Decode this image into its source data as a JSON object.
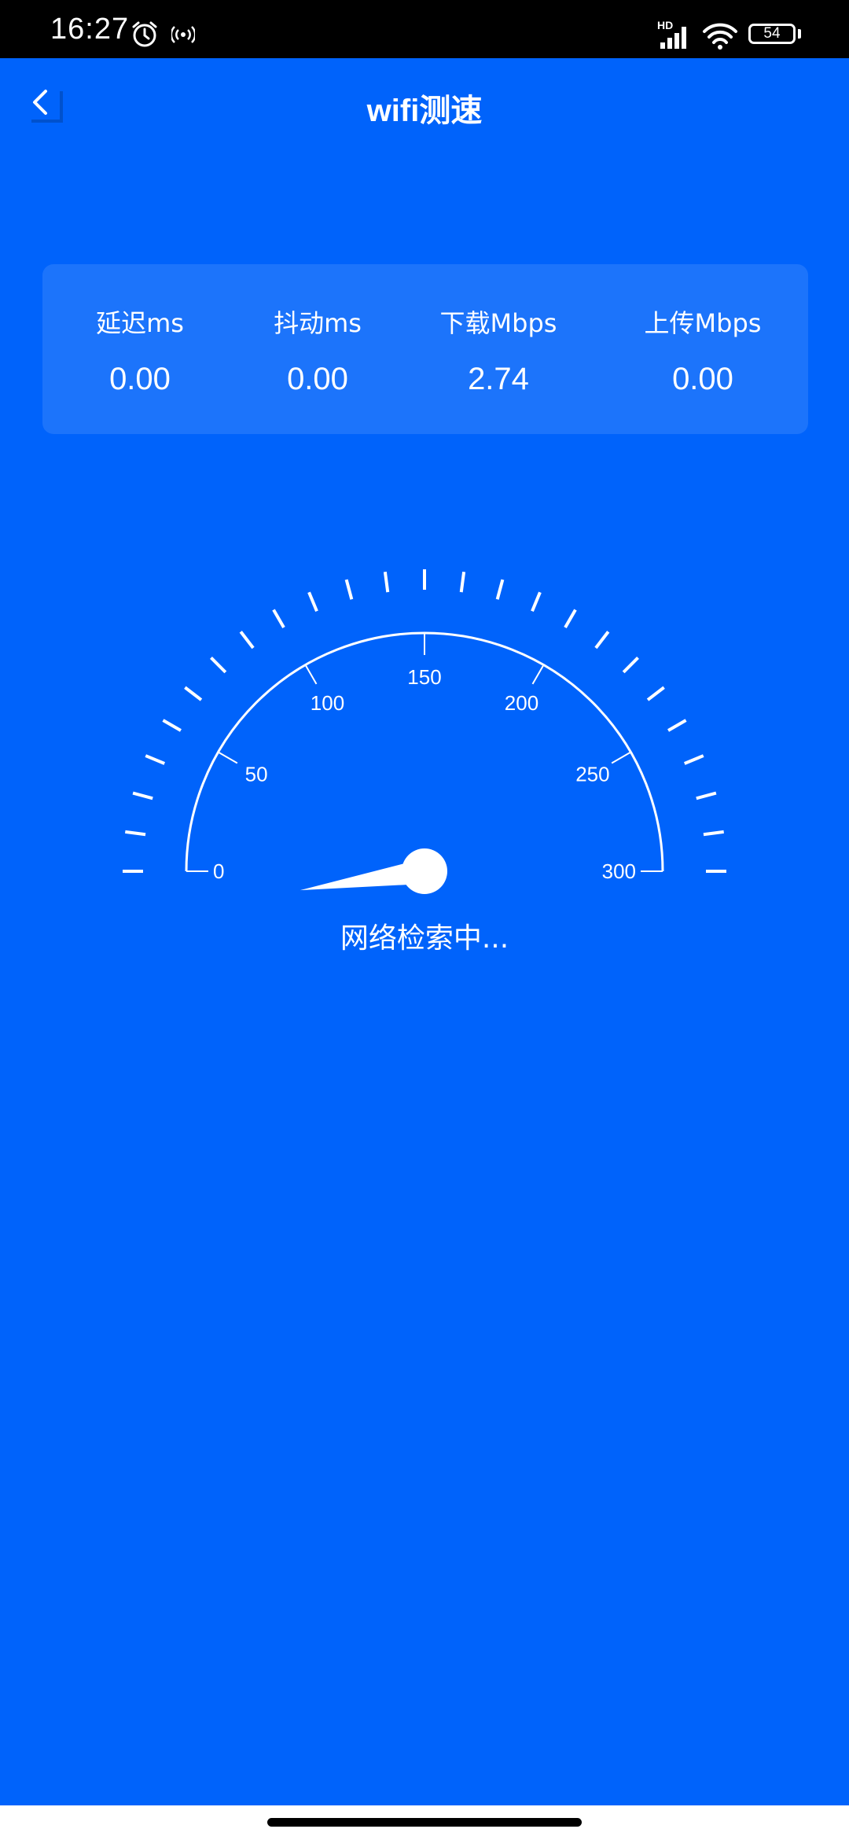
{
  "status_bar": {
    "time": "16:27",
    "network_label": "HD",
    "battery": "54",
    "icons": [
      "alarm-icon",
      "hotspot-icon",
      "signal-icon",
      "wifi-icon",
      "battery-icon"
    ]
  },
  "header": {
    "title": "wifi测速",
    "back_icon": "chevron-left-icon"
  },
  "stats": [
    {
      "label": "延迟ms",
      "value": "0.00"
    },
    {
      "label": "抖动ms",
      "value": "0.00"
    },
    {
      "label": "下载Mbps",
      "value": "2.74"
    },
    {
      "label": "上传Mbps",
      "value": "0.00"
    }
  ],
  "gauge": {
    "min": 0,
    "max": 300,
    "ticks": [
      "0",
      "50",
      "100",
      "150",
      "200",
      "250",
      "300"
    ],
    "current_value": 2.74
  },
  "status_text": "网络检索中...",
  "colors": {
    "background": "#0063fb",
    "foreground": "#ffffff"
  }
}
